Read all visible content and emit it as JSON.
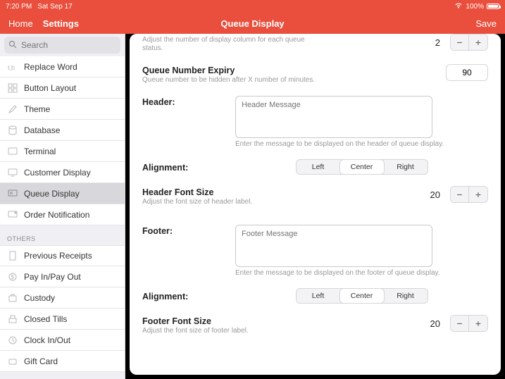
{
  "status": {
    "time": "7:20 PM",
    "date": "Sat Sep 17",
    "battery": "100%"
  },
  "nav": {
    "home": "Home",
    "settings": "Settings",
    "title": "Queue Display",
    "save": "Save"
  },
  "search": {
    "placeholder": "Search"
  },
  "sidebar": {
    "items": [
      {
        "label": "Replace Word"
      },
      {
        "label": "Button Layout"
      },
      {
        "label": "Theme"
      },
      {
        "label": "Database"
      },
      {
        "label": "Terminal"
      },
      {
        "label": "Customer Display"
      },
      {
        "label": "Queue Display"
      },
      {
        "label": "Order Notification"
      }
    ],
    "othersHeader": "OTHERS",
    "others": [
      {
        "label": "Previous Receipts"
      },
      {
        "label": "Pay In/Pay Out"
      },
      {
        "label": "Custody"
      },
      {
        "label": "Closed Tills"
      },
      {
        "label": "Clock In/Out"
      },
      {
        "label": "Gift Card"
      }
    ]
  },
  "form": {
    "numCol": {
      "sub": "Adjust the number of display column for each queue status.",
      "value": "2"
    },
    "expiry": {
      "title": "Queue Number Expiry",
      "sub": "Queue number to be hidden after X number of minutes.",
      "value": "90"
    },
    "header": {
      "title": "Header:",
      "placeholder": "Header Message",
      "helper": "Enter the message to be displayed on the header of queue display."
    },
    "alignment": {
      "title": "Alignment:",
      "left": "Left",
      "center": "Center",
      "right": "Right"
    },
    "headerFont": {
      "title": "Header Font Size",
      "sub": "Adjust the font size of header label.",
      "value": "20"
    },
    "footer": {
      "title": "Footer:",
      "placeholder": "Footer Message",
      "helper": "Enter the message to be displayed on the footer of queue display."
    },
    "footerFont": {
      "title": "Footer Font Size",
      "sub": "Adjust the font size of footer label.",
      "value": "20"
    }
  }
}
